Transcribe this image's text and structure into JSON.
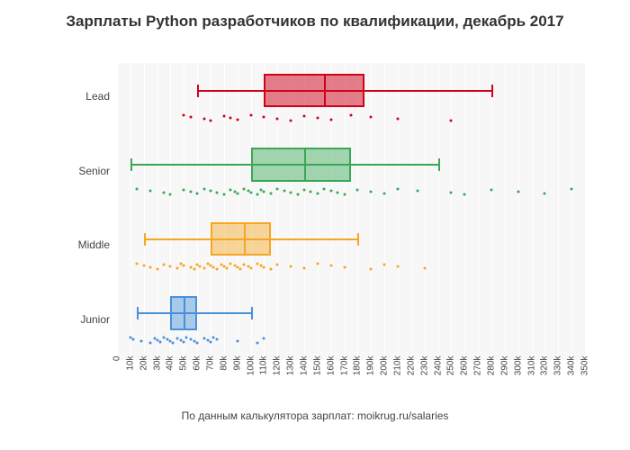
{
  "title": "Зарплаты Python разработчиков по квалификации, декабрь 2017",
  "x_caption": "По данным калькулятора зарплат: moikrug.ru/salaries",
  "y_labels": [
    "Lead",
    "Senior",
    "Middle",
    "Junior"
  ],
  "x_ticks": [
    "0",
    "10k",
    "20k",
    "30k",
    "40k",
    "50k",
    "60k",
    "70k",
    "80k",
    "90k",
    "100k",
    "110k",
    "120k",
    "130k",
    "140k",
    "150k",
    "160k",
    "170k",
    "180k",
    "190k",
    "200k",
    "210k",
    "220k",
    "230k",
    "240k",
    "250k",
    "260k",
    "270k",
    "280k",
    "290k",
    "300k",
    "310k",
    "320k",
    "330k",
    "340k",
    "350k"
  ],
  "chart_data": {
    "type": "boxplot",
    "orientation": "horizontal",
    "xlabel": "",
    "ylabel": "",
    "xlim": [
      0,
      350
    ],
    "x_unit": "k RUB",
    "categories": [
      "Junior",
      "Middle",
      "Senior",
      "Lead"
    ],
    "series": [
      {
        "name": "Junior",
        "color": "#4a90d9",
        "fill": "rgba(74,144,217,0.45)",
        "min": 15,
        "q1": 40,
        "median": 50,
        "q3": 60,
        "max": 100,
        "outliers": [
          10,
          12,
          18,
          25,
          28,
          30,
          32,
          35,
          38,
          40,
          42,
          45,
          48,
          50,
          52,
          55,
          58,
          60,
          65,
          68,
          70,
          72,
          75,
          90,
          105,
          110
        ]
      },
      {
        "name": "Middle",
        "color": "#f5a623",
        "fill": "rgba(245,166,35,0.45)",
        "min": 20,
        "q1": 70,
        "median": 95,
        "q3": 115,
        "max": 180,
        "outliers": [
          15,
          20,
          25,
          30,
          35,
          40,
          45,
          48,
          50,
          55,
          58,
          60,
          62,
          65,
          68,
          70,
          72,
          75,
          78,
          80,
          82,
          85,
          88,
          90,
          92,
          95,
          98,
          100,
          105,
          108,
          110,
          115,
          120,
          130,
          140,
          150,
          160,
          170,
          190,
          200,
          210,
          230
        ]
      },
      {
        "name": "Senior",
        "color": "#3aa757",
        "fill": "rgba(58,167,87,0.45)",
        "min": 10,
        "q1": 100,
        "median": 140,
        "q3": 175,
        "max": 240,
        "outliers": [
          15,
          25,
          35,
          40,
          50,
          55,
          60,
          65,
          70,
          75,
          80,
          85,
          88,
          90,
          95,
          98,
          100,
          105,
          108,
          110,
          115,
          120,
          125,
          130,
          135,
          140,
          145,
          150,
          155,
          160,
          165,
          170,
          180,
          190,
          200,
          210,
          225,
          250,
          260,
          280,
          300,
          320,
          340
        ]
      },
      {
        "name": "Lead",
        "color": "#d0021b",
        "fill": "rgba(208,2,27,0.50)",
        "min": 60,
        "q1": 110,
        "median": 155,
        "q3": 185,
        "max": 280,
        "outliers": [
          50,
          55,
          65,
          70,
          80,
          85,
          90,
          100,
          110,
          120,
          130,
          140,
          150,
          160,
          175,
          190,
          210,
          250
        ]
      }
    ]
  }
}
